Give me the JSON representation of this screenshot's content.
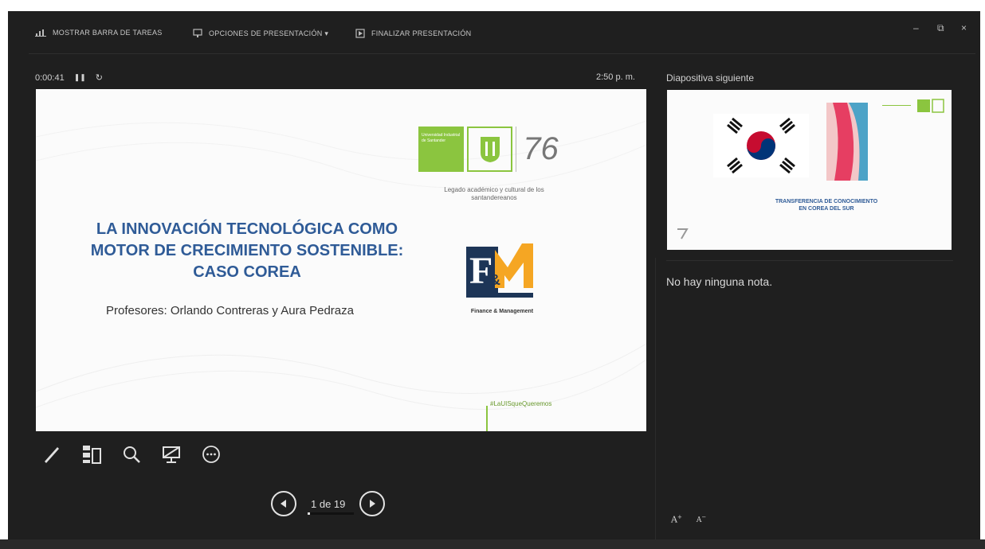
{
  "toolbar": {
    "show_taskbar": "MOSTRAR BARRA DE TAREAS",
    "presentation_options": "OPCIONES DE PRESENTACIÓN ▾",
    "end_presentation": "FINALIZAR PRESENTACIÓN",
    "minimize": "–",
    "restore": "⧉",
    "close": "×"
  },
  "timer": {
    "elapsed": "0:00:41",
    "pause": "❚❚",
    "reset": "↻"
  },
  "clock": "2:50 p. m.",
  "current_slide": {
    "title_lines": [
      "LA INNOVACIÓN TECNOLÓGICA COMO",
      "MOTOR DE CRECIMIENTO SOSTENIBLE:",
      "CASO COREA"
    ],
    "professors": "Profesores: Orlando Contreras y Aura Pedraza",
    "uis_text": "Universidad Industrial de Santander",
    "uis_76": "76",
    "legado": "Legado académico y cultural de los santandereanos",
    "fm_caption": "Finance & Management",
    "hashtag": "#LaUISqueQueremos"
  },
  "navigation": {
    "counter": "1 de 19",
    "progress_fraction": 0.0526
  },
  "next_panel": {
    "title": "Diapositiva siguiente",
    "caption_line1": "TRANSFERENCIA DE CONOCIMIENTO",
    "caption_line2": "EN COREA DEL SUR"
  },
  "notes": "No hay ninguna nota.",
  "colors": {
    "background": "#1f1f1f",
    "slide_title": "#2f5b97",
    "uis_green": "#8bc53f",
    "fm_orange": "#f5a623",
    "fm_navy": "#1d3557"
  },
  "icons": {
    "pen": "pen-icon",
    "grid": "see-all-slides-icon",
    "zoom": "zoom-icon",
    "screen": "black-screen-icon",
    "more": "more-options-icon",
    "prev": "previous-slide-icon",
    "next": "next-slide-icon"
  }
}
